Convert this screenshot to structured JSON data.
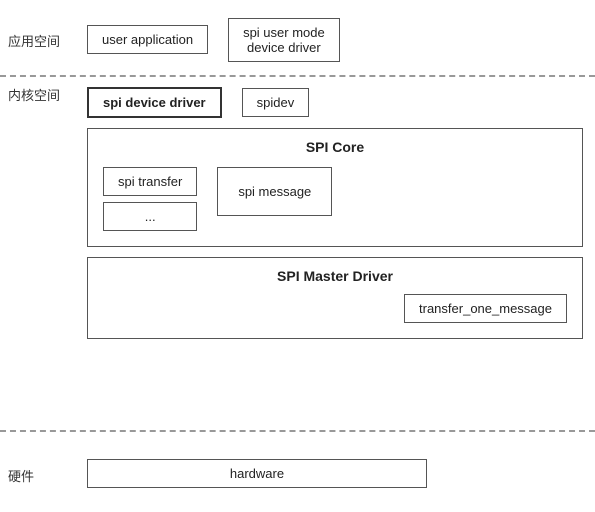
{
  "labels": {
    "app_space": "应用空间",
    "kernel_space": "内核空间",
    "hardware_space": "硬件"
  },
  "app_layer": {
    "user_application": "user application",
    "spi_user_mode": "spi user mode\ndevice driver"
  },
  "kernel_layer": {
    "spi_device_driver": "spi device driver",
    "spidev": "spidev",
    "spi_core": {
      "title": "SPI Core",
      "spi_transfer": "spi transfer",
      "ellipsis": "...",
      "spi_message": "spi message"
    },
    "spi_master": {
      "title": "SPI Master Driver",
      "transfer_one_message": "transfer_one_message"
    }
  },
  "hardware_layer": {
    "hardware": "hardware"
  }
}
